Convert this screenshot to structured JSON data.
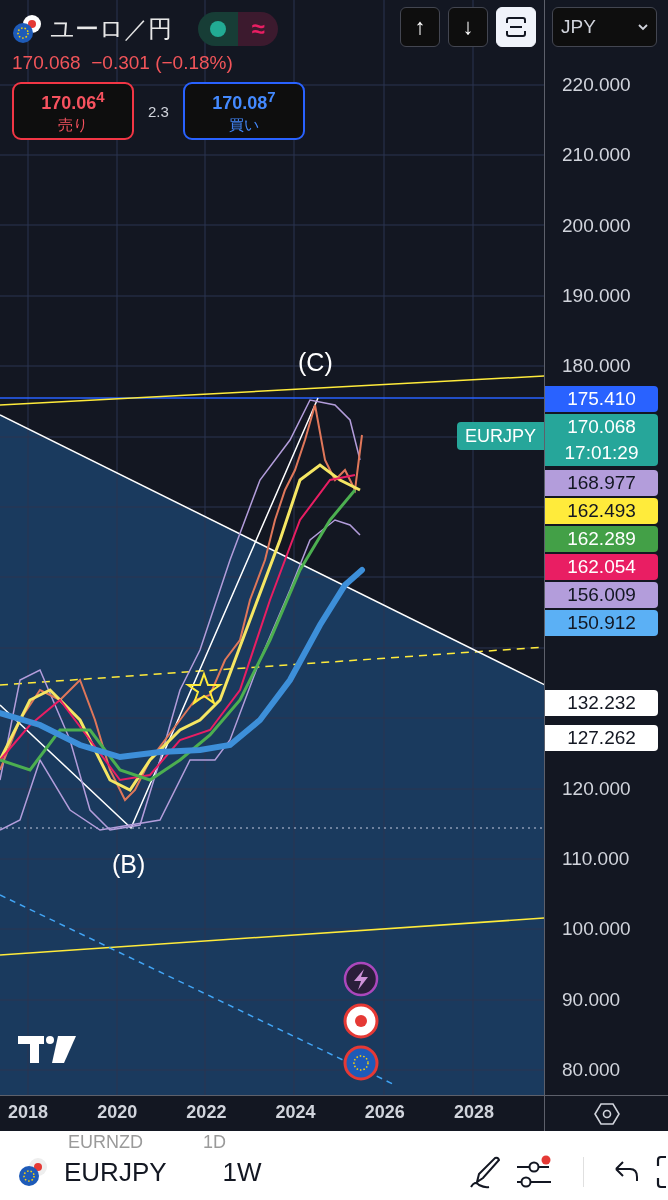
{
  "header": {
    "title": "ユーロ／円",
    "toggle_symbol": "≈",
    "quote": "170.068  −0.301 (−0.18%)",
    "sell": {
      "price": "170.06$^{4}$",
      "label": "売り"
    },
    "spread": "2.3",
    "buy": {
      "price": "170.08$^{7}$",
      "label": "買い"
    }
  },
  "toolbar": [
    {
      "kind": "text",
      "label": "↑",
      "selected": false
    },
    {
      "kind": "text",
      "label": "↓",
      "selected": false
    },
    {
      "kind": "frame",
      "selected": true
    }
  ],
  "currency": "JPY",
  "price_axis": [
    "220.000",
    "210.000",
    "200.000",
    "190.000",
    "180.000",
    "120.000",
    "110.000",
    "100.000",
    "90.000",
    "80.000"
  ],
  "price_tags": [
    {
      "value": "175.410",
      "color": "#2962ff"
    },
    {
      "value": "170.068",
      "time": "17:01:29",
      "color": "#26a69a"
    },
    {
      "value": "168.977",
      "color": "#b39ddb"
    },
    {
      "value": "162.493",
      "color": "#ffeb3b"
    },
    {
      "value": "162.289",
      "color": "#43a047"
    },
    {
      "value": "162.054",
      "color": "#e91e63"
    },
    {
      "value": "156.009",
      "color": "#b39ddb"
    },
    {
      "value": "150.912",
      "color": "#5bb0f5"
    },
    {
      "value": "132.232",
      "color": "#ffffff"
    },
    {
      "value": "127.262",
      "color": "#ffffff"
    }
  ],
  "symbol_tag": "EURJPY",
  "wave_labels": [
    "(C)",
    "(B)"
  ],
  "time_axis": [
    "2018",
    "2020",
    "2022",
    "2024",
    "2026",
    "2028"
  ],
  "bottom_bar": {
    "ghost": [
      "EURNZD",
      "1D"
    ],
    "symbol": "EURJPY",
    "interval": "1W",
    "indicator_alert": true
  }
}
